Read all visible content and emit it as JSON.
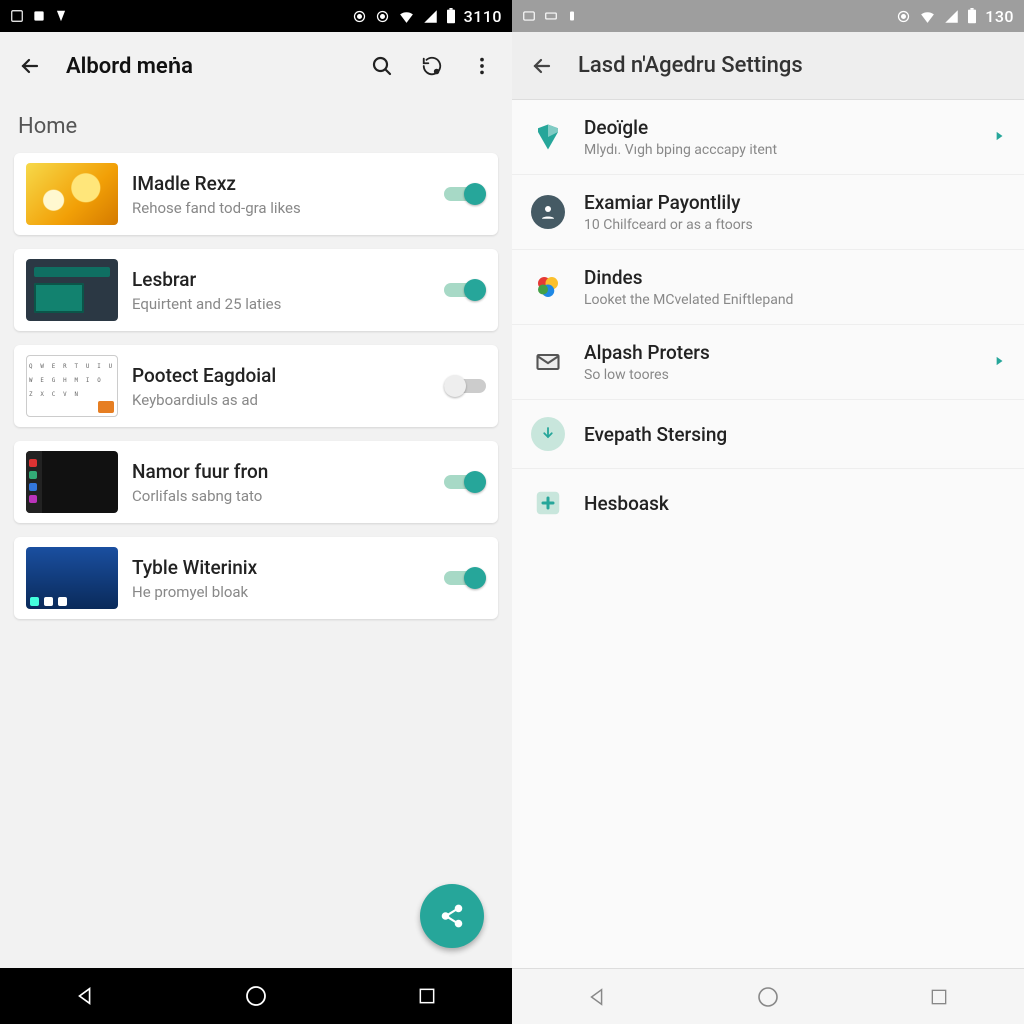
{
  "left": {
    "status": {
      "time": "3110"
    },
    "appbar": {
      "title": "Albord meṅa"
    },
    "section": "Home",
    "cards": [
      {
        "title": "IMadle Rexz",
        "subtitle": "Rehose fand tod-gra likes",
        "thumb": "food",
        "on": true
      },
      {
        "title": "Lesbrar",
        "subtitle": "Equirtent and 25 laties",
        "thumb": "widget",
        "on": true
      },
      {
        "title": "Pootect Eagdoial",
        "subtitle": "Keyboardiuls as ad",
        "thumb": "kb",
        "on": false
      },
      {
        "title": "Namor fuur fron",
        "subtitle": "Corlifals sabng tato",
        "thumb": "darkui",
        "on": true
      },
      {
        "title": "Tyble Witerinix",
        "subtitle": "He promyel bloak",
        "thumb": "win",
        "on": true
      }
    ]
  },
  "right": {
    "status": {
      "time": "130"
    },
    "appbar": {
      "title": "Lasd n'Agedru Settings"
    },
    "rows": [
      {
        "icon": "shield",
        "title": "Deoïgle",
        "subtitle": "Mlydı. Vıgh bping acccapy itent",
        "chev": true
      },
      {
        "icon": "person",
        "title": "Examiar Payontlily",
        "subtitle": "10 Chilfceard or as a ftoors",
        "chev": false
      },
      {
        "icon": "colors",
        "title": "Dindes",
        "subtitle": "Looket the MCvelated Eniftlepand",
        "chev": false
      },
      {
        "icon": "mail",
        "title": "Alpash Proters",
        "subtitle": "So low toores",
        "chev": true
      },
      {
        "icon": "download",
        "title": "Evepath Stersing",
        "subtitle": "",
        "chev": false
      },
      {
        "icon": "plus",
        "title": "Hesboask",
        "subtitle": "",
        "chev": false
      }
    ]
  }
}
